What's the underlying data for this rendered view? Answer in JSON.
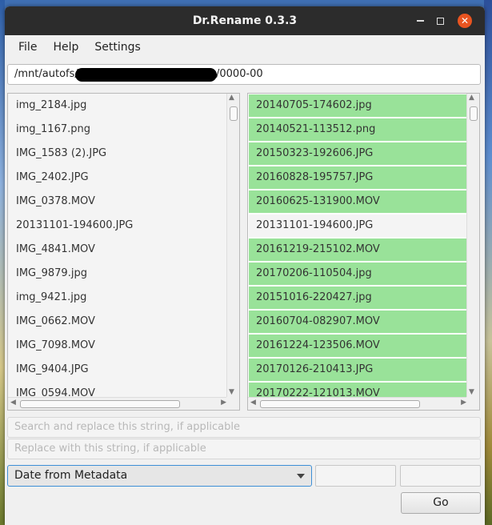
{
  "window": {
    "title": "Dr.Rename 0.3.3"
  },
  "menu": {
    "file": "File",
    "help": "Help",
    "settings": "Settings"
  },
  "path": {
    "prefix": "/mnt/autofs/",
    "suffix": "/0000-00"
  },
  "original_files": [
    "img_2184.jpg",
    "img_1167.png",
    "IMG_1583 (2).JPG",
    "IMG_2402.JPG",
    "IMG_0378.MOV",
    "20131101-194600.JPG",
    "IMG_4841.MOV",
    "IMG_9879.jpg",
    "img_9421.jpg",
    "IMG_0662.MOV",
    "IMG_7098.MOV",
    "IMG_9404.JPG",
    "IMG_0594.MOV"
  ],
  "renamed_files": [
    {
      "name": "20140705-174602.jpg",
      "status": "changed"
    },
    {
      "name": "20140521-113512.png",
      "status": "changed"
    },
    {
      "name": "20150323-192606.JPG",
      "status": "changed"
    },
    {
      "name": "20160828-195757.JPG",
      "status": "changed"
    },
    {
      "name": "20160625-131900.MOV",
      "status": "changed"
    },
    {
      "name": "20131101-194600.JPG",
      "status": "same"
    },
    {
      "name": "20161219-215102.MOV",
      "status": "changed"
    },
    {
      "name": "20170206-110504.jpg",
      "status": "changed"
    },
    {
      "name": "20151016-220427.jpg",
      "status": "changed"
    },
    {
      "name": "20160704-082907.MOV",
      "status": "changed"
    },
    {
      "name": "20161224-123506.MOV",
      "status": "changed"
    },
    {
      "name": "20170126-210413.JPG",
      "status": "changed"
    },
    {
      "name": "20170222-121013.MOV",
      "status": "changed"
    }
  ],
  "search_field": {
    "placeholder": "Search and replace this string, if applicable"
  },
  "replace_field": {
    "placeholder": "Replace with this string, if applicable"
  },
  "mode_select": {
    "selected": "Date from Metadata"
  },
  "go_button": {
    "label": "Go"
  },
  "colors": {
    "changed_row": "#99e299",
    "focus_border": "#3d8fd6",
    "close_button": "#e95420"
  }
}
